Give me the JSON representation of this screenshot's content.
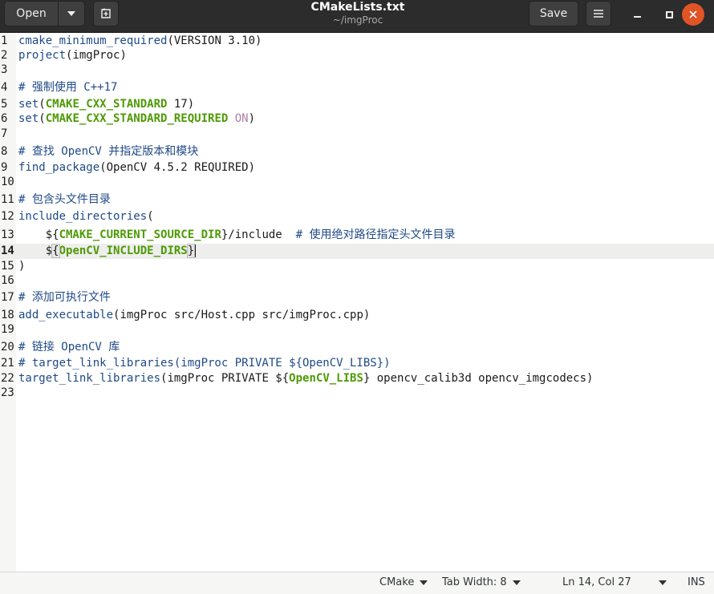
{
  "header": {
    "open_label": "Open",
    "save_label": "Save",
    "title": "CMakeLists.txt",
    "subtitle": "~/imgProc"
  },
  "editor": {
    "current_line": 14,
    "lines": [
      {
        "n": "1",
        "segs": [
          {
            "t": "cmake_minimum_required",
            "c": "fn"
          },
          {
            "t": "(VERSION 3.10)",
            "c": ""
          }
        ]
      },
      {
        "n": "2",
        "segs": [
          {
            "t": "project",
            "c": "fn"
          },
          {
            "t": "(imgProc)",
            "c": ""
          }
        ]
      },
      {
        "n": "3",
        "segs": []
      },
      {
        "n": "4",
        "segs": [
          {
            "t": "# 强制使用 C++17",
            "c": "cm"
          }
        ]
      },
      {
        "n": "5",
        "segs": [
          {
            "t": "set",
            "c": "fn"
          },
          {
            "t": "(",
            "c": ""
          },
          {
            "t": "CMAKE_CXX_STANDARD",
            "c": "kw"
          },
          {
            "t": " 17)",
            "c": ""
          }
        ]
      },
      {
        "n": "6",
        "segs": [
          {
            "t": "set",
            "c": "fn"
          },
          {
            "t": "(",
            "c": ""
          },
          {
            "t": "CMAKE_CXX_STANDARD_REQUIRED",
            "c": "kw"
          },
          {
            "t": " ",
            "c": ""
          },
          {
            "t": "ON",
            "c": "cn"
          },
          {
            "t": ")",
            "c": ""
          }
        ]
      },
      {
        "n": "7",
        "segs": []
      },
      {
        "n": "8",
        "segs": [
          {
            "t": "# 查找 OpenCV 并指定版本和模块",
            "c": "cm"
          }
        ]
      },
      {
        "n": "9",
        "segs": [
          {
            "t": "find_package",
            "c": "fn"
          },
          {
            "t": "(OpenCV 4.5.2 REQUIRED)",
            "c": ""
          }
        ]
      },
      {
        "n": "10",
        "segs": []
      },
      {
        "n": "11",
        "segs": [
          {
            "t": "# 包含头文件目录",
            "c": "cm"
          }
        ]
      },
      {
        "n": "12",
        "segs": [
          {
            "t": "include_directories",
            "c": "fn"
          },
          {
            "t": "(",
            "c": ""
          }
        ]
      },
      {
        "n": "13",
        "segs": [
          {
            "t": "    ${",
            "c": ""
          },
          {
            "t": "CMAKE_CURRENT_SOURCE_DIR",
            "c": "kw"
          },
          {
            "t": "}/include  ",
            "c": ""
          },
          {
            "t": "# 使用绝对路径指定头文件目录",
            "c": "cm"
          }
        ]
      },
      {
        "n": "14",
        "segs": [
          {
            "t": "    $",
            "c": ""
          },
          {
            "t": "{",
            "c": "br"
          },
          {
            "t": "OpenCV_INCLUDE_DIRS",
            "c": "kw"
          },
          {
            "t": "}",
            "c": "br"
          }
        ]
      },
      {
        "n": "15",
        "segs": [
          {
            "t": ")",
            "c": ""
          }
        ]
      },
      {
        "n": "16",
        "segs": []
      },
      {
        "n": "17",
        "segs": [
          {
            "t": "# 添加可执行文件",
            "c": "cm"
          }
        ]
      },
      {
        "n": "18",
        "segs": [
          {
            "t": "add_executable",
            "c": "fn"
          },
          {
            "t": "(imgProc src/Host.cpp src/imgProc.cpp)",
            "c": ""
          }
        ]
      },
      {
        "n": "19",
        "segs": []
      },
      {
        "n": "20",
        "segs": [
          {
            "t": "# 链接 OpenCV 库",
            "c": "cm"
          }
        ]
      },
      {
        "n": "21",
        "segs": [
          {
            "t": "# target_link_libraries(imgProc PRIVATE ${OpenCV_LIBS})",
            "c": "cm"
          }
        ]
      },
      {
        "n": "22",
        "segs": [
          {
            "t": "target_link_libraries",
            "c": "fn"
          },
          {
            "t": "(imgProc PRIVATE ${",
            "c": ""
          },
          {
            "t": "OpenCV_LIBS",
            "c": "kw"
          },
          {
            "t": "} opencv_calib3d opencv_imgcodecs)",
            "c": ""
          }
        ]
      },
      {
        "n": "23",
        "segs": []
      }
    ]
  },
  "statusbar": {
    "language": "CMake",
    "tab_width": "Tab Width: 8",
    "position": "Ln 14, Col 27",
    "mode": "INS"
  },
  "colors": {
    "headerbar": "#2c2c2c",
    "function": "#204a87",
    "variable": "#4e9a06",
    "constant": "#ad7fa8",
    "close_button": "#e05426"
  },
  "icons": [
    "chevron-down-icon",
    "new-tab-icon",
    "hamburger-menu-icon",
    "minimize-icon",
    "maximize-icon",
    "close-icon"
  ]
}
